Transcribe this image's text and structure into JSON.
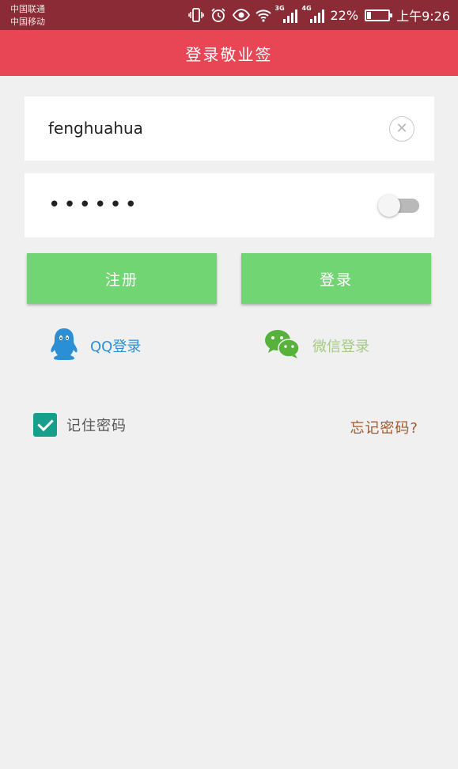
{
  "status_bar": {
    "carrier_1": "中国联通",
    "carrier_2": "中国移动",
    "network_1": "3G",
    "network_2": "4G",
    "battery": "22%",
    "battery_level": 0.22,
    "time": "上午9:26",
    "icons": [
      "vibrate-icon",
      "alarm-icon",
      "eye-icon",
      "wifi-icon",
      "signal-icon",
      "battery-icon"
    ]
  },
  "header": {
    "title": "登录敬业签"
  },
  "form": {
    "username": {
      "value": "fenghuahua"
    },
    "password": {
      "value": "••••••"
    }
  },
  "buttons": {
    "register": "注册",
    "login": "登录"
  },
  "social": {
    "qq": "QQ登录",
    "wechat": "微信登录"
  },
  "remember": {
    "label": "记住密码",
    "checked": true
  },
  "forgot": {
    "label": "忘记密码?"
  },
  "colors": {
    "status_bar": "#8b2b35",
    "title_bar": "#e84655",
    "button_green": "#72d573",
    "qq_blue": "#2b8fd6",
    "wechat_green": "#56b23a",
    "checkbox_teal": "#169f8a",
    "forgot_brown": "#a4582a"
  }
}
